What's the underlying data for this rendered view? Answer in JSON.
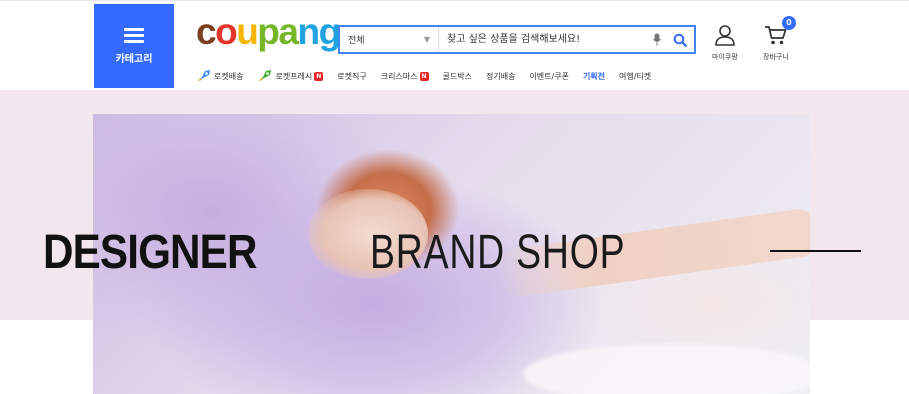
{
  "header": {
    "category_label": "카테고리",
    "logo": {
      "letters": [
        "c",
        "o",
        "u",
        "p",
        "a",
        "n",
        "g"
      ],
      "colors": [
        "#7b3f1f",
        "#e4352a",
        "#f7b500",
        "#76b72a",
        "#76b72a",
        "#1fa2e0",
        "#1fa2e0"
      ]
    },
    "search": {
      "category_value": "전체",
      "placeholder": "찾고 싶은 상품을 검색해보세요!"
    },
    "mypage_label": "마이쿠팡",
    "cart_label": "장바구니",
    "cart_count": "0"
  },
  "nav": {
    "items": [
      {
        "label": "로켓배송",
        "icon": "rocket-blue-icon"
      },
      {
        "label": "로켓프레시",
        "icon": "rocket-green-icon",
        "badge": "N"
      },
      {
        "label": "로켓직구"
      },
      {
        "label": "크리스마스",
        "badge": "N"
      },
      {
        "label": "골드박스"
      },
      {
        "label": "정기배송"
      },
      {
        "label": "이벤트/쿠폰"
      },
      {
        "label": "기획전",
        "active": true
      },
      {
        "label": "여행/티켓"
      }
    ]
  },
  "banner": {
    "headline_bold": "DESIGNER",
    "headline_thin": "BRAND SHOP"
  },
  "colors": {
    "accent": "#346aff",
    "badge_red": "#e52528",
    "banner_bg": "#f1e7ec"
  }
}
